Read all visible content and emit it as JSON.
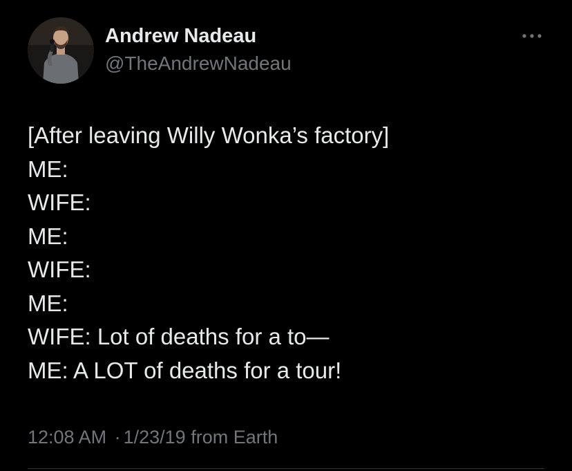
{
  "author": {
    "display_name": "Andrew Nadeau",
    "handle": "@TheAndrewNadeau",
    "avatar_icon": "person-with-microphone-photo"
  },
  "more_icon": "ellipsis-icon",
  "body": {
    "lines": [
      "[After leaving Willy Wonka’s factory]",
      "ME:",
      "WIFE:",
      "ME:",
      "WIFE:",
      "ME:",
      "WIFE: Lot of deaths for a to—",
      "ME: A LOT of deaths for a tour!"
    ]
  },
  "meta": {
    "time": "12:08 AM",
    "separator": "·",
    "date": "1/23/19",
    "source": "from Earth"
  },
  "colors": {
    "background": "#000000",
    "primary_text": "#e7e9ea",
    "secondary_text": "#71767b",
    "divider": "#2f3336"
  }
}
